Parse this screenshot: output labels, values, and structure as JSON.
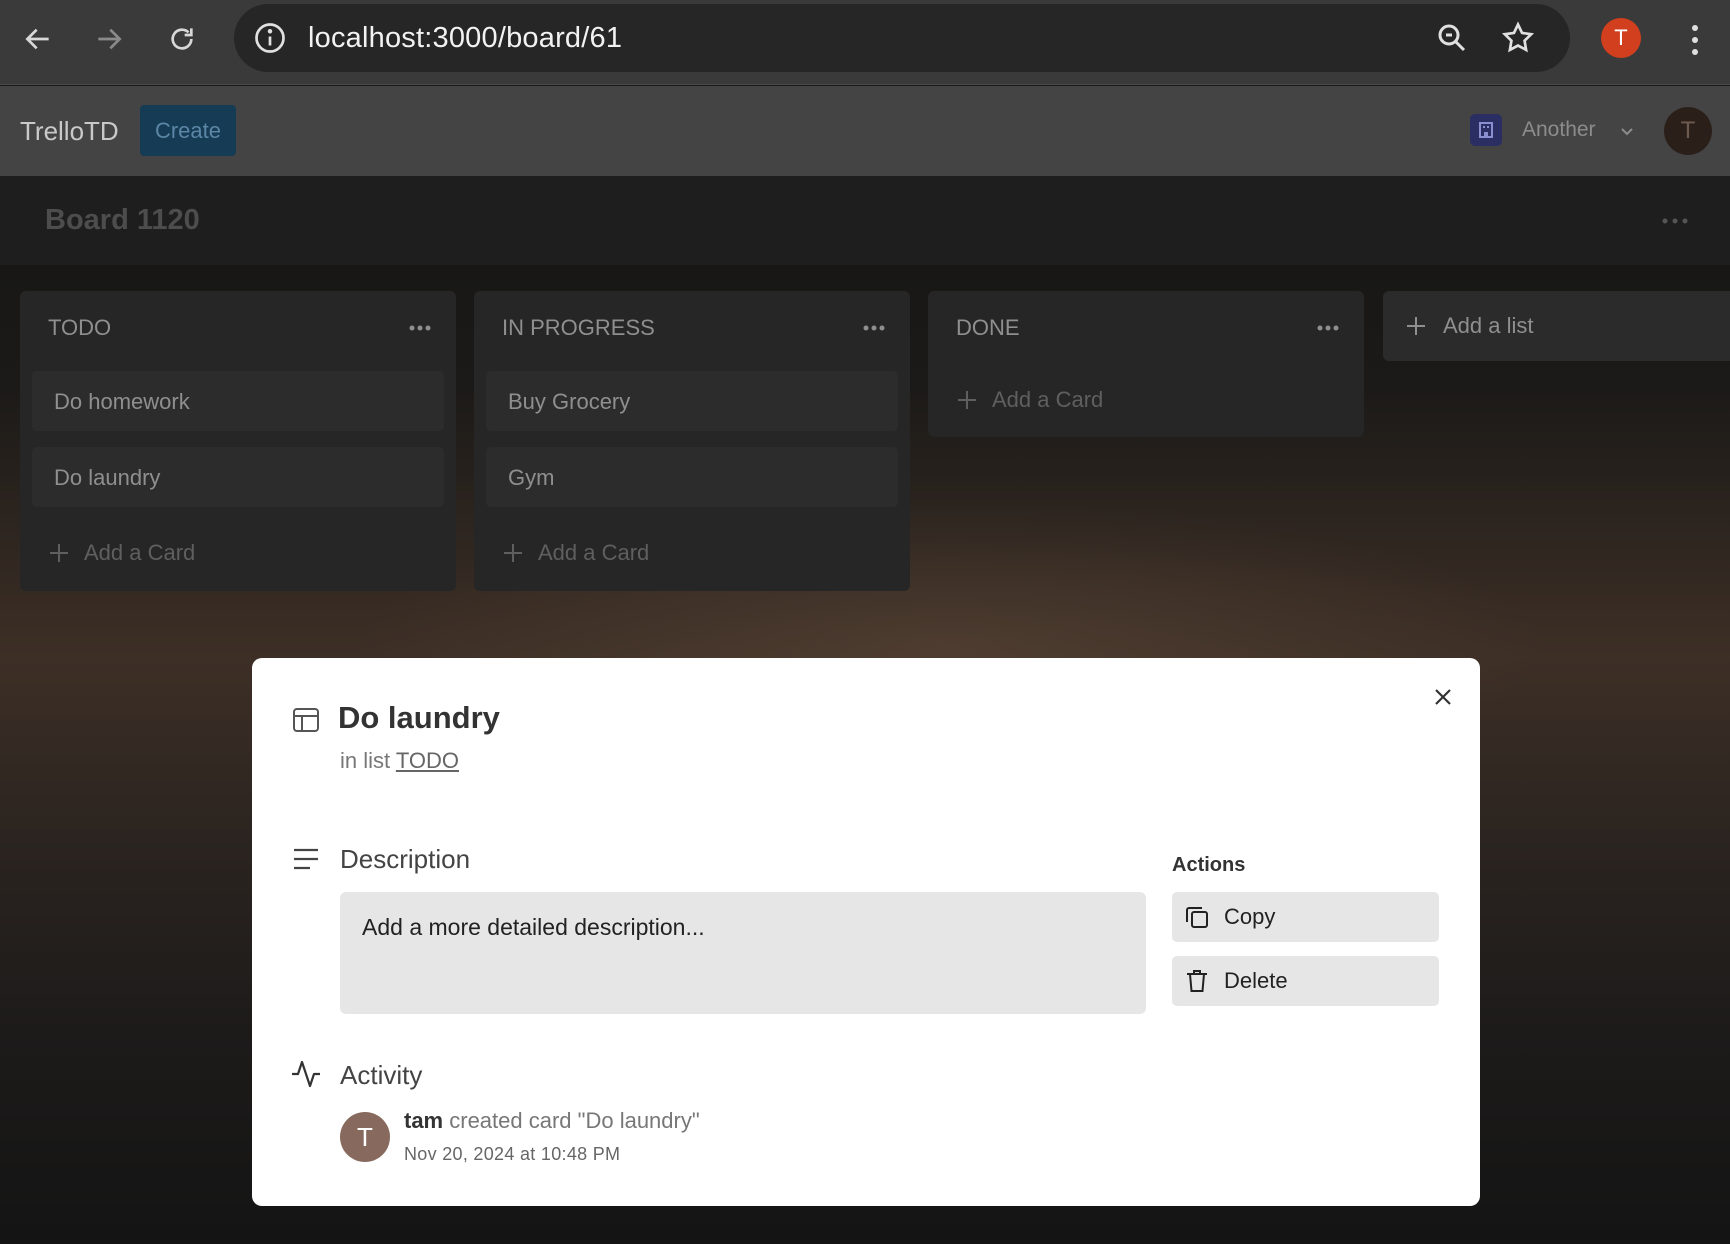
{
  "browser": {
    "url": "localhost:3000/board/61",
    "profile_initial": "T"
  },
  "header": {
    "brand": "TrelloTD",
    "create_label": "Create",
    "workspace_name": "Another",
    "avatar_initial": "T"
  },
  "board": {
    "title": "Board 1120",
    "lists": [
      {
        "title": "TODO",
        "cards": [
          "Do homework",
          "Do laundry"
        ],
        "add_card_label": "Add a Card"
      },
      {
        "title": "IN PROGRESS",
        "cards": [
          "Buy Grocery",
          "Gym"
        ],
        "add_card_label": "Add a Card"
      },
      {
        "title": "DONE",
        "cards": [],
        "add_card_label": "Add a Card"
      }
    ],
    "add_list_label": "Add a list"
  },
  "modal": {
    "card_title": "Do laundry",
    "in_list_prefix": "in list",
    "list_name": "TODO",
    "description_label": "Description",
    "description_placeholder": "Add a more detailed description...",
    "actions_label": "Actions",
    "copy_label": "Copy",
    "delete_label": "Delete",
    "activity_label": "Activity",
    "activity": {
      "avatar_initial": "T",
      "user": "tam",
      "text": "created card \"Do laundry\"",
      "time": "Nov 20, 2024 at 10:48 PM"
    }
  },
  "colors": {
    "accent": "#163b55",
    "profile": "#d23f1e",
    "activity_avatar": "#876a5d"
  }
}
